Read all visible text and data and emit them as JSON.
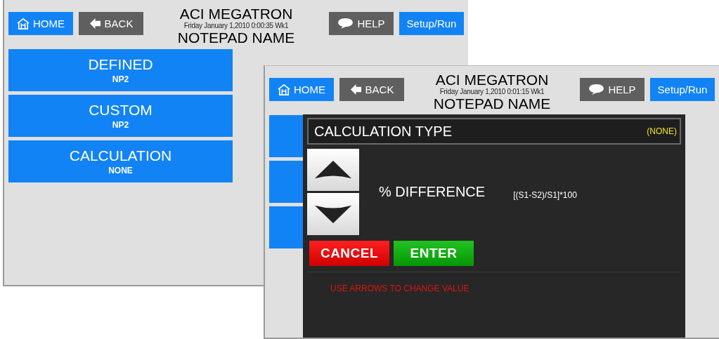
{
  "screens": [
    {
      "home": "HOME",
      "back": "BACK",
      "title": "ACI MEGATRON",
      "datetime": "Friday January 1,2010 0:00:35 Wk1",
      "notepad": "NOTEPAD NAME",
      "help": "HELP",
      "setup": "Setup/Run",
      "menu": [
        {
          "label": "DEFINED",
          "value": "NP2"
        },
        {
          "label": "CUSTOM",
          "value": "NP2"
        },
        {
          "label": "CALCULATION",
          "value": "NONE"
        }
      ]
    },
    {
      "home": "HOME",
      "back": "BACK",
      "title": "ACI MEGATRON",
      "datetime": "Friday January 1,2010 0:01:15 Wk1",
      "notepad": "NOTEPAD NAME",
      "help": "HELP",
      "setup": "Setup/Run",
      "dialog": {
        "title": "CALCULATION TYPE",
        "current": "(NONE)",
        "option": "% DIFFERENCE",
        "formula": "[(S1-S2)/S1]*100",
        "buttons": [
          {
            "kind": "cancel",
            "label": "CANCEL"
          },
          {
            "kind": "enter",
            "label": "ENTER"
          }
        ],
        "hint": "USE ARROWS TO CHANGE VALUE"
      }
    }
  ]
}
